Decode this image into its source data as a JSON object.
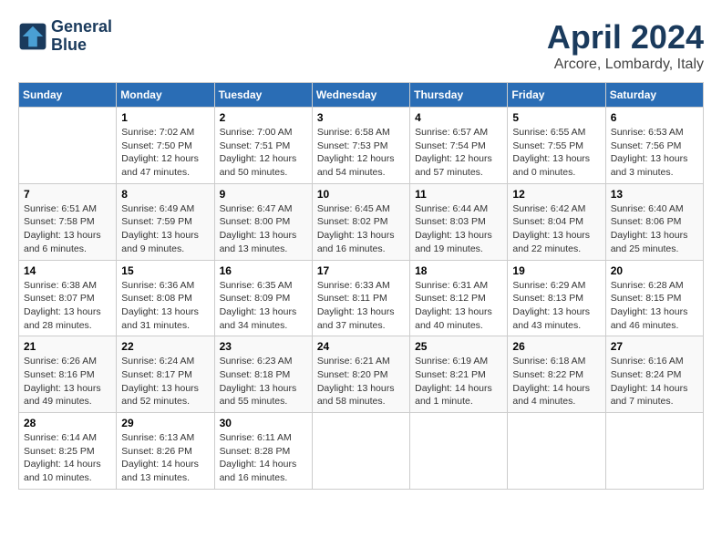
{
  "header": {
    "logo_line1": "General",
    "logo_line2": "Blue",
    "month_title": "April 2024",
    "location": "Arcore, Lombardy, Italy"
  },
  "weekdays": [
    "Sunday",
    "Monday",
    "Tuesday",
    "Wednesday",
    "Thursday",
    "Friday",
    "Saturday"
  ],
  "weeks": [
    [
      {
        "day": "",
        "info": ""
      },
      {
        "day": "1",
        "info": "Sunrise: 7:02 AM\nSunset: 7:50 PM\nDaylight: 12 hours\nand 47 minutes."
      },
      {
        "day": "2",
        "info": "Sunrise: 7:00 AM\nSunset: 7:51 PM\nDaylight: 12 hours\nand 50 minutes."
      },
      {
        "day": "3",
        "info": "Sunrise: 6:58 AM\nSunset: 7:53 PM\nDaylight: 12 hours\nand 54 minutes."
      },
      {
        "day": "4",
        "info": "Sunrise: 6:57 AM\nSunset: 7:54 PM\nDaylight: 12 hours\nand 57 minutes."
      },
      {
        "day": "5",
        "info": "Sunrise: 6:55 AM\nSunset: 7:55 PM\nDaylight: 13 hours\nand 0 minutes."
      },
      {
        "day": "6",
        "info": "Sunrise: 6:53 AM\nSunset: 7:56 PM\nDaylight: 13 hours\nand 3 minutes."
      }
    ],
    [
      {
        "day": "7",
        "info": "Sunrise: 6:51 AM\nSunset: 7:58 PM\nDaylight: 13 hours\nand 6 minutes."
      },
      {
        "day": "8",
        "info": "Sunrise: 6:49 AM\nSunset: 7:59 PM\nDaylight: 13 hours\nand 9 minutes."
      },
      {
        "day": "9",
        "info": "Sunrise: 6:47 AM\nSunset: 8:00 PM\nDaylight: 13 hours\nand 13 minutes."
      },
      {
        "day": "10",
        "info": "Sunrise: 6:45 AM\nSunset: 8:02 PM\nDaylight: 13 hours\nand 16 minutes."
      },
      {
        "day": "11",
        "info": "Sunrise: 6:44 AM\nSunset: 8:03 PM\nDaylight: 13 hours\nand 19 minutes."
      },
      {
        "day": "12",
        "info": "Sunrise: 6:42 AM\nSunset: 8:04 PM\nDaylight: 13 hours\nand 22 minutes."
      },
      {
        "day": "13",
        "info": "Sunrise: 6:40 AM\nSunset: 8:06 PM\nDaylight: 13 hours\nand 25 minutes."
      }
    ],
    [
      {
        "day": "14",
        "info": "Sunrise: 6:38 AM\nSunset: 8:07 PM\nDaylight: 13 hours\nand 28 minutes."
      },
      {
        "day": "15",
        "info": "Sunrise: 6:36 AM\nSunset: 8:08 PM\nDaylight: 13 hours\nand 31 minutes."
      },
      {
        "day": "16",
        "info": "Sunrise: 6:35 AM\nSunset: 8:09 PM\nDaylight: 13 hours\nand 34 minutes."
      },
      {
        "day": "17",
        "info": "Sunrise: 6:33 AM\nSunset: 8:11 PM\nDaylight: 13 hours\nand 37 minutes."
      },
      {
        "day": "18",
        "info": "Sunrise: 6:31 AM\nSunset: 8:12 PM\nDaylight: 13 hours\nand 40 minutes."
      },
      {
        "day": "19",
        "info": "Sunrise: 6:29 AM\nSunset: 8:13 PM\nDaylight: 13 hours\nand 43 minutes."
      },
      {
        "day": "20",
        "info": "Sunrise: 6:28 AM\nSunset: 8:15 PM\nDaylight: 13 hours\nand 46 minutes."
      }
    ],
    [
      {
        "day": "21",
        "info": "Sunrise: 6:26 AM\nSunset: 8:16 PM\nDaylight: 13 hours\nand 49 minutes."
      },
      {
        "day": "22",
        "info": "Sunrise: 6:24 AM\nSunset: 8:17 PM\nDaylight: 13 hours\nand 52 minutes."
      },
      {
        "day": "23",
        "info": "Sunrise: 6:23 AM\nSunset: 8:18 PM\nDaylight: 13 hours\nand 55 minutes."
      },
      {
        "day": "24",
        "info": "Sunrise: 6:21 AM\nSunset: 8:20 PM\nDaylight: 13 hours\nand 58 minutes."
      },
      {
        "day": "25",
        "info": "Sunrise: 6:19 AM\nSunset: 8:21 PM\nDaylight: 14 hours\nand 1 minute."
      },
      {
        "day": "26",
        "info": "Sunrise: 6:18 AM\nSunset: 8:22 PM\nDaylight: 14 hours\nand 4 minutes."
      },
      {
        "day": "27",
        "info": "Sunrise: 6:16 AM\nSunset: 8:24 PM\nDaylight: 14 hours\nand 7 minutes."
      }
    ],
    [
      {
        "day": "28",
        "info": "Sunrise: 6:14 AM\nSunset: 8:25 PM\nDaylight: 14 hours\nand 10 minutes."
      },
      {
        "day": "29",
        "info": "Sunrise: 6:13 AM\nSunset: 8:26 PM\nDaylight: 14 hours\nand 13 minutes."
      },
      {
        "day": "30",
        "info": "Sunrise: 6:11 AM\nSunset: 8:28 PM\nDaylight: 14 hours\nand 16 minutes."
      },
      {
        "day": "",
        "info": ""
      },
      {
        "day": "",
        "info": ""
      },
      {
        "day": "",
        "info": ""
      },
      {
        "day": "",
        "info": ""
      }
    ]
  ]
}
